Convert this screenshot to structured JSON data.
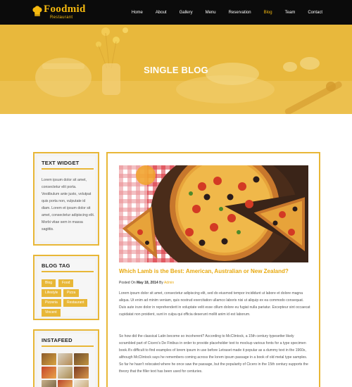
{
  "brand": {
    "name": "Foodmid",
    "tagline": "Restaurant",
    "accent": "#f5b90f"
  },
  "nav": {
    "items": [
      "Home",
      "About",
      "Gallery",
      "Menu",
      "Reservation",
      "Blog",
      "Team",
      "Contact"
    ],
    "active": "Blog"
  },
  "banner": {
    "title": "SINGLE BLOG"
  },
  "sidebar": {
    "text_widget": {
      "title": "TEXT WIDGET",
      "body": "Lorem ipsum dolor sit amet, consectetur elit porta. Vestibulum ante justo, volutpat quis porta non, vulputate id diam. Lorem et ipsum dolor sit amet, consectetur adipiscing elit. Morbi vitae sem in massa sagittis."
    },
    "blog_tag": {
      "title": "BLOG TAG",
      "tags": [
        "Blog",
        "Food",
        "Lifestyle",
        "Pizza",
        "Pizzeria",
        "Restaurant",
        "Vincent"
      ]
    },
    "instafeed": {
      "title": "INSTAFEED"
    }
  },
  "post": {
    "title": "Which Lamb is the Best: American, Australian or New Zealand?",
    "meta_prefix": "Posted On ",
    "date": "May 18, 2014",
    "by": " By ",
    "author": "Admin",
    "paragraph1": "Lorem ipsum dolor sit amet, consectetur adipiscing elit, sed do eiusmod tempor incididunt ut labore et dolore magna aliqua. Ut enim ad minim veniam, quis nostrud exercitation ullamco laboris nisi ut aliquip ex ea commodo consequat. Duis aute irure dolor in reprehenderit in voluptate velit esse cillum dolore eu fugiat nulla pariatur. Excepteur sint occaecat cupidatat non proident, sunt in culpa qui officia deserunt mollit anim id est laborum.",
    "paragraph2": "So how did the classical Latin become so incoherent? According to McClintock, a 15th century typesetter likely scrambled part of Cicero's De Finibus in order to provide placeholder text to mockup various fonts for a type specimen book.It's difficult to find examples of lorem ipsum in use before Letraset made it popular as a dummy text in the 1960s, although McClintock says he remembers coming across the lorem ipsum passage in a book of old metal type samples. So far he hasn't relocated where he once saw the passage, but the popularity of Cicero in the 15th century supports the theory that the filler text has been used for centuries."
  }
}
